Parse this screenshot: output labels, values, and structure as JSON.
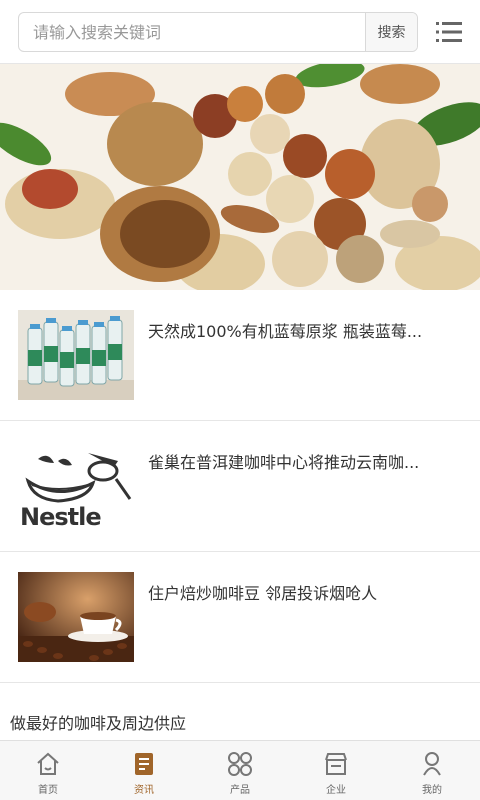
{
  "search": {
    "placeholder": "请输入搜索关键词",
    "value": "",
    "button_label": "搜索"
  },
  "banner": {
    "dots": 2,
    "active_dot": 1
  },
  "news": [
    {
      "title": "天然成100%有机蓝莓原浆 瓶装蓝莓..."
    },
    {
      "title": "雀巢在普洱建咖啡中心将推动云南咖...",
      "logo_text": "Nestle"
    },
    {
      "title": "住户焙炒咖啡豆 邻居投诉烟呛人"
    }
  ],
  "slogan": "做最好的咖啡及周边供应",
  "nav": [
    {
      "label": "首页",
      "icon": "home-icon",
      "active": false
    },
    {
      "label": "资讯",
      "icon": "news-icon",
      "active": true
    },
    {
      "label": "产品",
      "icon": "grid-icon",
      "active": false
    },
    {
      "label": "企业",
      "icon": "shop-icon",
      "active": false
    },
    {
      "label": "我的",
      "icon": "user-icon",
      "active": false
    }
  ],
  "colors": {
    "accent": "#a0652a",
    "nav_bg": "#f7f7f7"
  }
}
